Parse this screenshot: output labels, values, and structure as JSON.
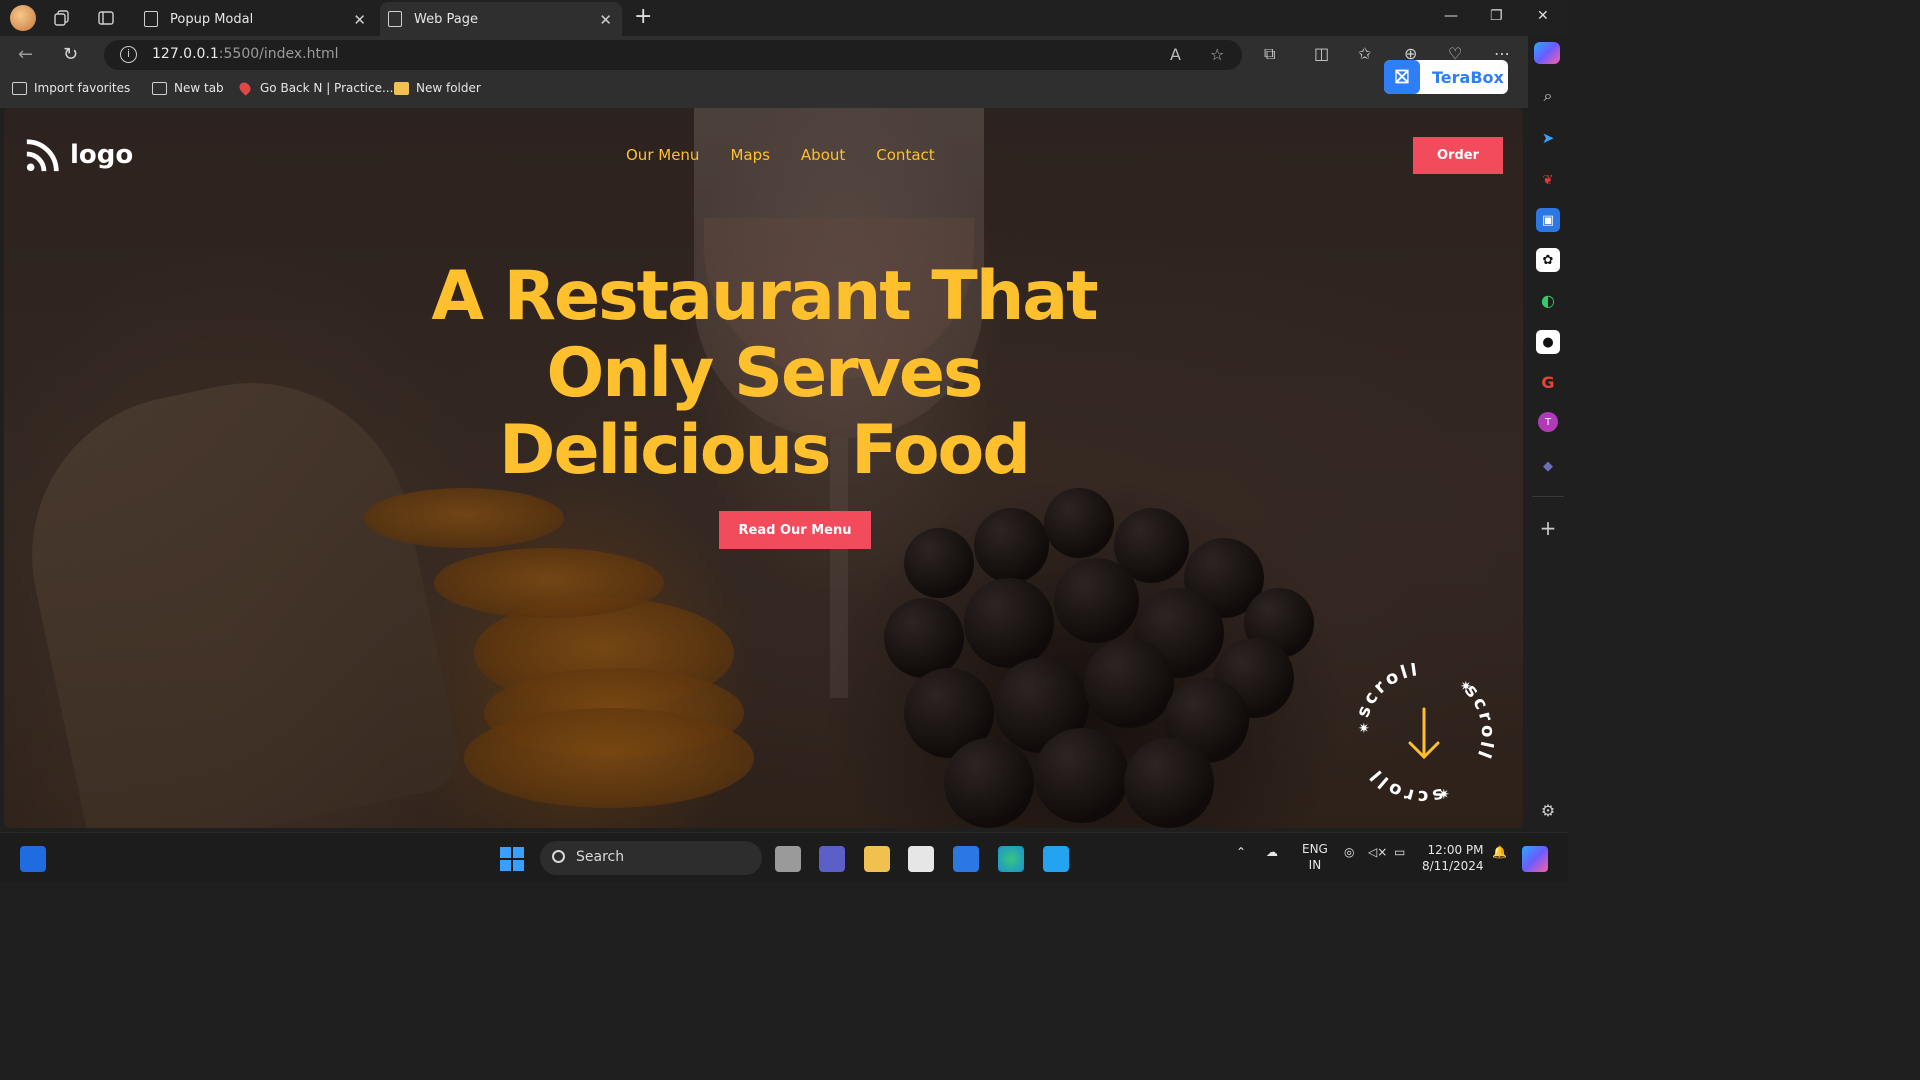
{
  "browser": {
    "tabs": [
      {
        "title": "Popup Modal",
        "active": false
      },
      {
        "title": "Web Page",
        "active": true
      }
    ],
    "address": {
      "host": "127.0.0.1",
      "rest": ":5500/index.html"
    },
    "bookmarks": [
      "Import favorites",
      "New tab",
      "Go Back N | Practice...",
      "New folder"
    ],
    "extension_badge": "TeraBox"
  },
  "site": {
    "logo_text": "logo",
    "nav": [
      "Our Menu",
      "Maps",
      "About",
      "Contact"
    ],
    "order_label": "Order",
    "hero_lines": [
      "A Restaurant That",
      "Only Serves",
      "Delicious Food"
    ],
    "cta_label": "Read Our Menu",
    "scroll_text": "scroll",
    "colors": {
      "accent": "#ffc02e",
      "button": "#f24b5c"
    }
  },
  "taskbar": {
    "search_label": "Search",
    "lang_top": "ENG",
    "lang_bottom": "IN",
    "time": "12:00 PM",
    "date": "8/11/2024"
  }
}
